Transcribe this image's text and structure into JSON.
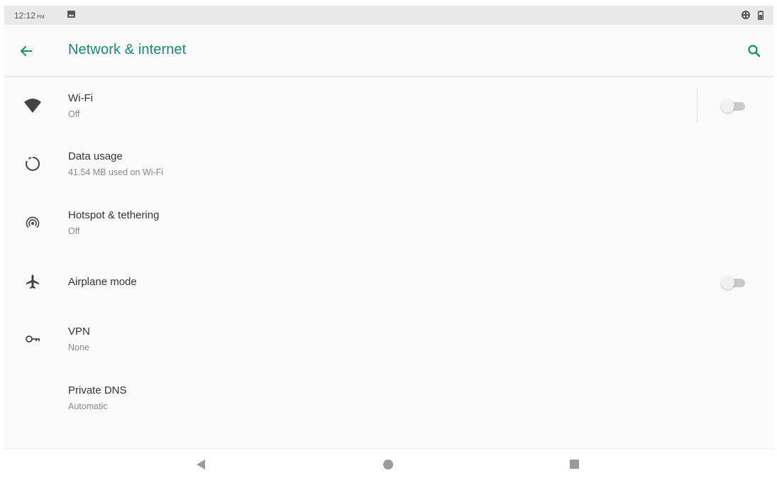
{
  "status_bar": {
    "time": "12:12",
    "ampm": "PM",
    "left_icons": [
      "photo-icon"
    ],
    "right_icons": [
      "data-saver-icon",
      "battery-icon"
    ]
  },
  "app_bar": {
    "title": "Network & internet",
    "back_icon": "arrow-back-icon",
    "search_icon": "search-icon",
    "accent_color": "#1a8a72"
  },
  "settings": [
    {
      "id": "wifi",
      "title": "Wi-Fi",
      "summary": "Off",
      "icon": "wifi-icon",
      "toggle": false
    },
    {
      "id": "data-usage",
      "title": "Data usage",
      "summary": "41.54 MB used on Wi-Fi",
      "icon": "data-usage-icon"
    },
    {
      "id": "hotspot",
      "title": "Hotspot & tethering",
      "summary": "Off",
      "icon": "hotspot-icon"
    },
    {
      "id": "airplane",
      "title": "Airplane mode",
      "icon": "airplane-icon",
      "toggle": false
    },
    {
      "id": "vpn",
      "title": "VPN",
      "summary": "None",
      "icon": "vpn-key-icon"
    },
    {
      "id": "private-dns",
      "title": "Private DNS",
      "summary": "Automatic"
    }
  ],
  "nav_bar": {
    "buttons": [
      "back-triangle-icon",
      "home-circle-icon",
      "recents-square-icon"
    ]
  }
}
